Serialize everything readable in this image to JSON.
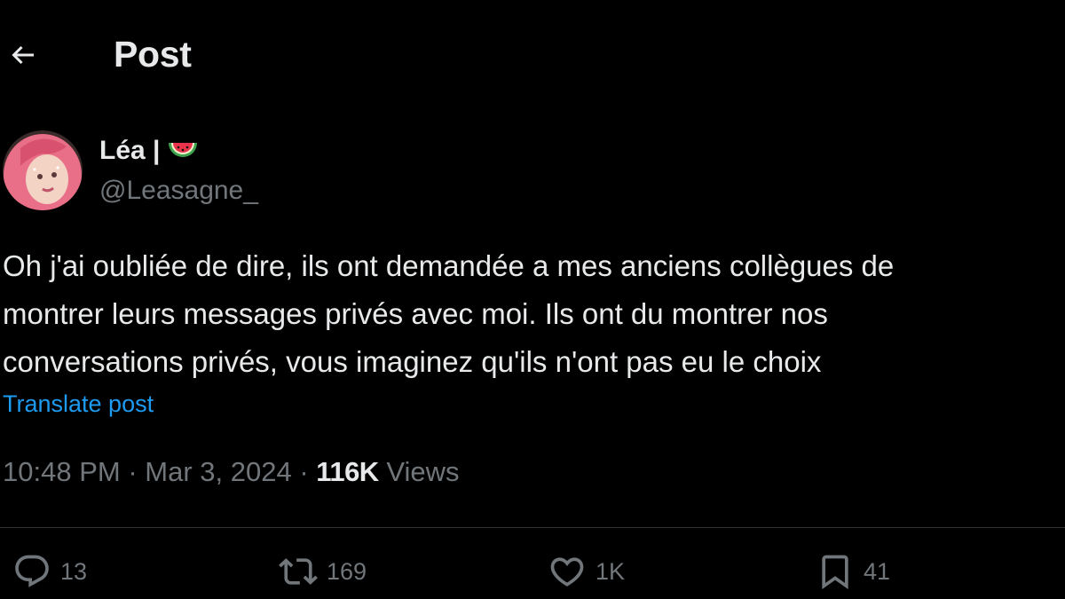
{
  "header": {
    "title": "Post",
    "back_icon": "arrow-left-icon"
  },
  "author": {
    "display_name": "Léa |",
    "badge_icon": "watermelon-icon",
    "handle": "@Leasagne_",
    "avatar_colors": [
      "#f28c9b",
      "#d94a6a",
      "#f5d6c8"
    ]
  },
  "post": {
    "lines": [
      "Oh j'ai oubliée de dire, ils ont demandée a mes anciens collègues de",
      "montrer leurs messages privés avec moi. Ils ont du montrer nos",
      "conversations privés, vous imaginez qu'ils n'ont pas eu le choix"
    ],
    "translate_label": "Translate post"
  },
  "meta": {
    "time": "10:48 PM",
    "separator": "·",
    "date": "Mar 3, 2024",
    "views_count": "116K",
    "views_label": "Views"
  },
  "actions": {
    "replies": "13",
    "reposts": "169",
    "likes": "1K",
    "bookmarks": "41"
  },
  "colors": {
    "background": "#000000",
    "text": "#e7e9ea",
    "secondary": "#71767b",
    "accent": "#1d9bf0",
    "divider": "#2f3336"
  }
}
